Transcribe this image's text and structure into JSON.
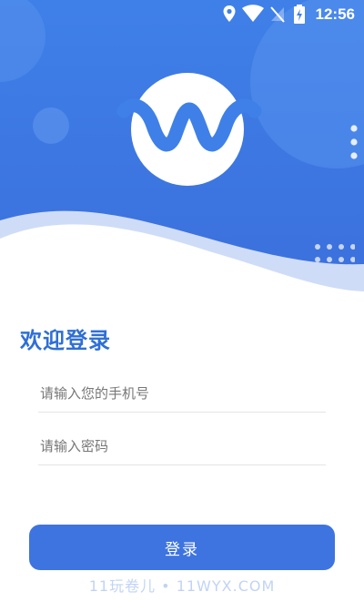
{
  "status_bar": {
    "time": "12:56",
    "icons": [
      "location-icon",
      "wifi-icon",
      "no-signal-icon",
      "battery-charging-icon"
    ]
  },
  "header": {
    "logo": "w-wave-logo-icon",
    "colors": {
      "top": "#3f7fe6",
      "bottom": "#3a6fdc",
      "wave_light": "#cfdcf7"
    }
  },
  "login": {
    "title": "欢迎登录",
    "phone_placeholder": "请输入您的手机号",
    "password_placeholder": "请输入密码",
    "submit_label": "登录"
  },
  "watermark": "11玩卷儿 • 11WYX.COM",
  "colors": {
    "accent": "#2f6fd6",
    "button": "#3e74e0"
  }
}
